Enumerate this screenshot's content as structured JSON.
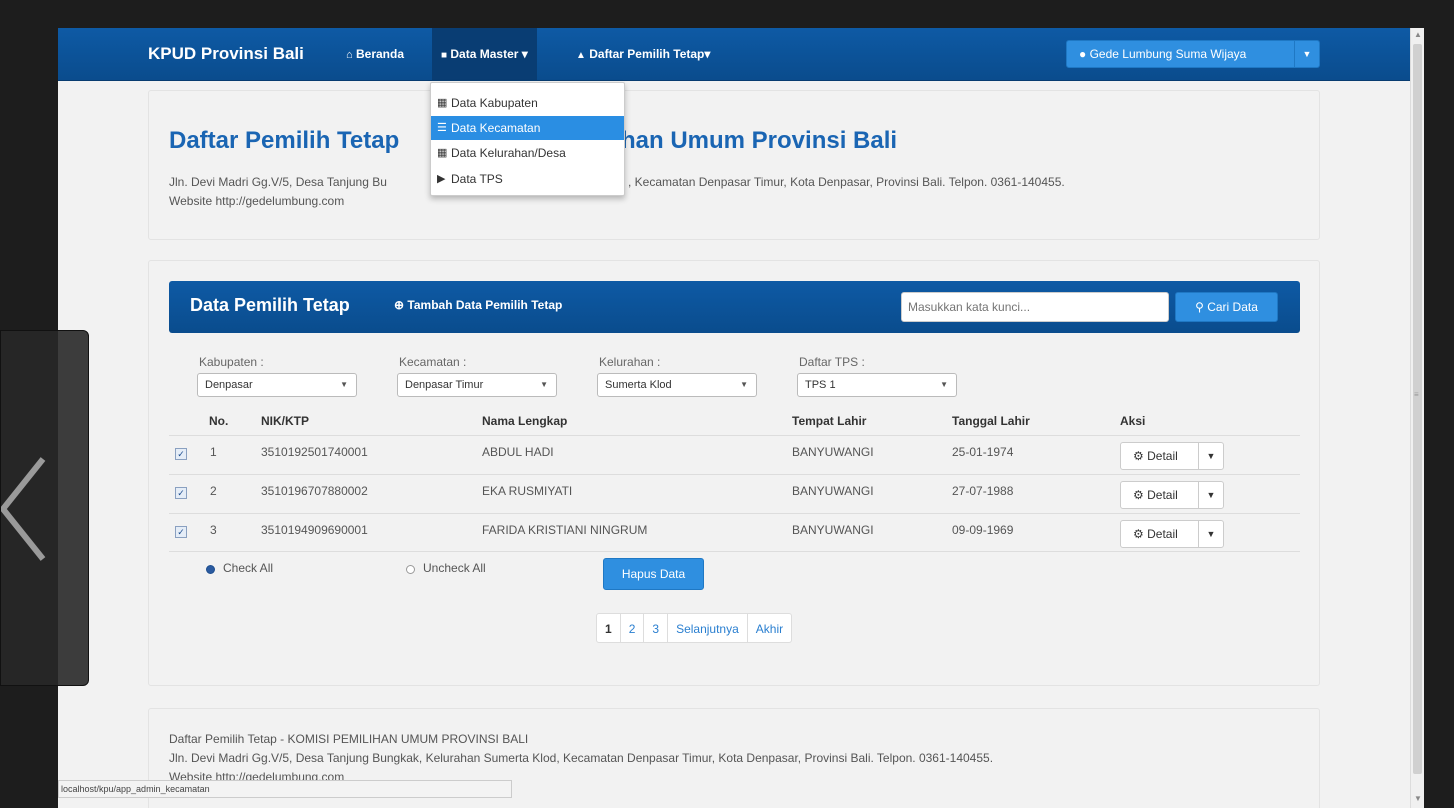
{
  "navbar": {
    "brand": "KPUD Provinsi Bali",
    "items": [
      {
        "label": "Beranda"
      },
      {
        "label": "Data Master ▾"
      },
      {
        "label": "Daftar Pemilih Tetap▾"
      }
    ],
    "user": "Gede Lumbung Suma Wijaya"
  },
  "dropdown": {
    "items": [
      {
        "label": "Data Kabupaten"
      },
      {
        "label": "Data Kecamatan"
      },
      {
        "label": "Data Kelurahan/Desa"
      },
      {
        "label": "Data TPS"
      }
    ]
  },
  "header": {
    "title_left": "Daftar Pemilih Tetap",
    "title_right": "han Umum Provinsi Bali",
    "address_left": "Jln. Devi Madri Gg.V/5, Desa Tanjung Bu",
    "address_right": ", Kecamatan Denpasar Timur, Kota Denpasar, Provinsi Bali. Telpon. 0361-140455.",
    "website": "Website http://gedelumbung.com"
  },
  "data_panel": {
    "title": "Data Pemilih Tetap",
    "add_label": "Tambah Data Pemilih Tetap",
    "search_placeholder": "Masukkan kata kunci...",
    "search_button": "Cari Data"
  },
  "filters": [
    {
      "label": "Kabupaten :",
      "value": "Denpasar"
    },
    {
      "label": "Kecamatan :",
      "value": "Denpasar Timur"
    },
    {
      "label": "Kelurahan :",
      "value": "Sumerta Klod"
    },
    {
      "label": "Daftar TPS :",
      "value": "TPS 1"
    }
  ],
  "table": {
    "headers": [
      "No.",
      "NIK/KTP",
      "Nama Lengkap",
      "Tempat Lahir",
      "Tanggal Lahir",
      "Aksi"
    ],
    "rows": [
      {
        "no": "1",
        "nik": "3510192501740001",
        "nama": "ABDUL HADI",
        "tempat": "BANYUWANGI",
        "tanggal": "25-01-1974"
      },
      {
        "no": "2",
        "nik": "3510196707880002",
        "nama": "EKA RUSMIYATI",
        "tempat": "BANYUWANGI",
        "tanggal": "27-07-1988"
      },
      {
        "no": "3",
        "nik": "3510194909690001",
        "nama": "FARIDA KRISTIANI NINGRUM",
        "tempat": "BANYUWANGI",
        "tanggal": "09-09-1969"
      }
    ],
    "detail_label": "Detail"
  },
  "controls": {
    "check_all": "Check All",
    "uncheck_all": "Uncheck All",
    "hapus": "Hapus Data"
  },
  "pagination": [
    "1",
    "2",
    "3",
    "Selanjutnya",
    "Akhir"
  ],
  "footer": {
    "line1": "Daftar Pemilih Tetap - KOMISI PEMILIHAN UMUM PROVINSI BALI",
    "line2": "Jln. Devi Madri Gg.V/5, Desa Tanjung Bungkak, Kelurahan Sumerta Klod, Kecamatan Denpasar Timur, Kota Denpasar, Provinsi Bali. Telpon. 0361-140455.",
    "line3": "Website http://gedelumbung.com"
  },
  "status_url": "localhost/kpu/app_admin_kecamatan",
  "colors": {
    "navbar": "#0a4c8d",
    "accent": "#2f8fe0",
    "title": "#1a65b3"
  }
}
